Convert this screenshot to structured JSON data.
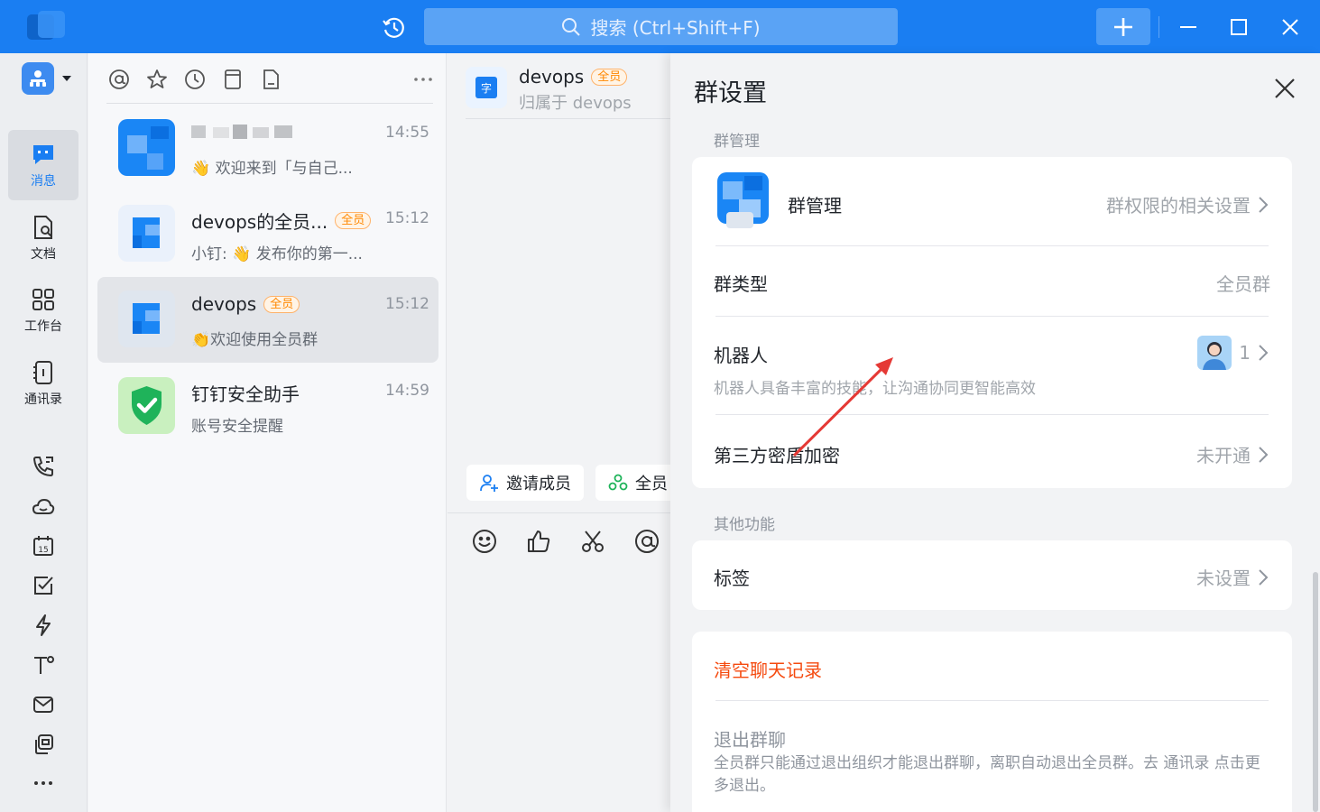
{
  "titlebar": {
    "search_placeholder": "搜索 (Ctrl+Shift+F)"
  },
  "rail": {
    "nav": [
      {
        "label": "消息",
        "icon": "message-icon",
        "active": true
      },
      {
        "label": "文档",
        "icon": "document-icon",
        "active": false
      },
      {
        "label": "工作台",
        "icon": "workbench-icon",
        "active": false
      },
      {
        "label": "通讯录",
        "icon": "contacts-icon",
        "active": false
      }
    ],
    "tools": [
      "phone-icon",
      "cloud-icon",
      "calendar-icon",
      "todo-icon",
      "flash-icon",
      "typography-icon",
      "mail-icon",
      "app-icon",
      "more-icon"
    ]
  },
  "conversations": [
    {
      "name": "",
      "time": "14:55",
      "preview": "👋 欢迎来到「与自己..."
    },
    {
      "name": "devops的全员...",
      "tag": "全员",
      "time": "15:12",
      "preview": "小钉: 👋 发布你的第一..."
    },
    {
      "name": "devops",
      "tag": "全员",
      "time": "15:12",
      "preview": "👏欢迎使用全员群"
    },
    {
      "name": "钉钉安全助手",
      "time": "14:59",
      "preview": "账号安全提醒"
    }
  ],
  "chat": {
    "name": "devops",
    "tag": "全员",
    "sub": "归属于 devops",
    "avatar_char": "字",
    "chips": [
      "邀请成员",
      "全员"
    ]
  },
  "settings": {
    "title": "群设置",
    "group_mgmt_section": "群管理",
    "group_mgmt_label": "群管理",
    "group_mgmt_value": "群权限的相关设置",
    "group_type_label": "群类型",
    "group_type_value": "全员群",
    "robot_label": "机器人",
    "robot_count": "1",
    "robot_sub": "机器人具备丰富的技能，让沟通协同更智能高效",
    "encryption_label": "第三方密盾加密",
    "encryption_value": "未开通",
    "other_section": "其他功能",
    "tag_label": "标签",
    "tag_value": "未设置",
    "clear_history": "清空聊天记录",
    "quit_label": "退出群聊",
    "quit_desc": "全员群只能通过退出组织才能退出群聊，离职自动退出全员群。去 通讯录 点击更多退出。"
  },
  "colors": {
    "brand": "#1a7ef2",
    "danger": "#f54a0f",
    "tag": "#ff8800",
    "annotation_arrow": "#e53935"
  }
}
